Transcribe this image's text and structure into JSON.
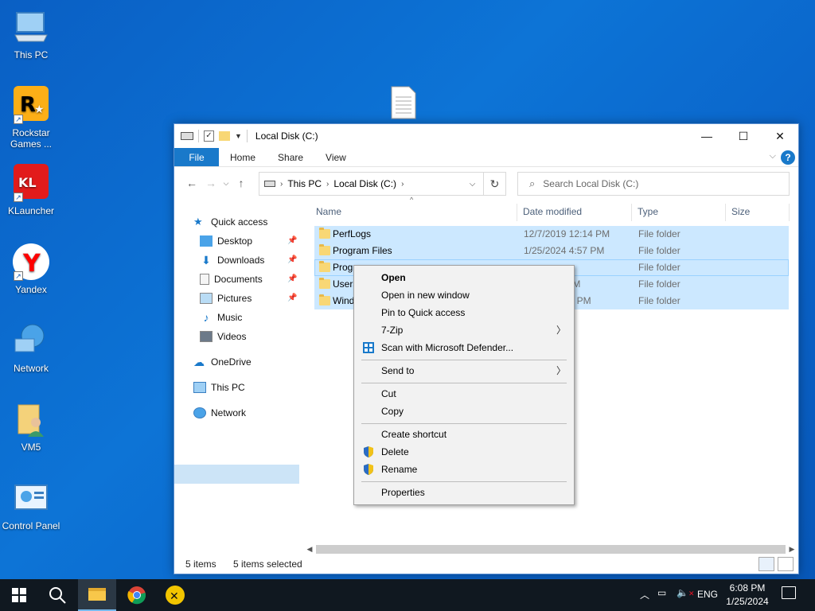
{
  "desktop": {
    "icons": [
      {
        "label": "This PC"
      },
      {
        "label": "Rockstar Games ..."
      },
      {
        "label": "KLauncher"
      },
      {
        "label": "Yandex"
      },
      {
        "label": "Network"
      },
      {
        "label": "VM5"
      },
      {
        "label": "Control Panel"
      }
    ]
  },
  "explorer": {
    "title": "Local Disk (C:)",
    "ribbon_tabs": {
      "file": "File",
      "home": "Home",
      "share": "Share",
      "view": "View"
    },
    "address": {
      "crumb1": "This PC",
      "crumb2": "Local Disk (C:)"
    },
    "search": {
      "placeholder": "Search Local Disk (C:)"
    },
    "nav": {
      "quick_access": "Quick access",
      "desktop": "Desktop",
      "downloads": "Downloads",
      "documents": "Documents",
      "pictures": "Pictures",
      "music": "Music",
      "videos": "Videos",
      "onedrive": "OneDrive",
      "this_pc": "This PC",
      "network": "Network"
    },
    "columns": {
      "name": "Name",
      "date": "Date modified",
      "type": "Type",
      "size": "Size"
    },
    "rows": [
      {
        "name": "PerfLogs",
        "date": "12/7/2019 12:14 PM",
        "type": "File folder"
      },
      {
        "name": "Program Files",
        "date": "1/25/2024 4:57 PM",
        "type": "File folder"
      },
      {
        "name": "Progr",
        "date": "",
        "type": "File folder"
      },
      {
        "name": "Users",
        "date": "1 AM",
        "type": "File folder"
      },
      {
        "name": "Wind",
        "date": "52 PM",
        "type": "File folder"
      }
    ],
    "status": {
      "items": "5 items",
      "selected": "5 items selected"
    }
  },
  "context_menu": {
    "open": "Open",
    "open_new_window": "Open in new window",
    "pin_quick_access": "Pin to Quick access",
    "seven_zip": "7-Zip",
    "scan_defender": "Scan with Microsoft Defender...",
    "send_to": "Send to",
    "cut": "Cut",
    "copy": "Copy",
    "create_shortcut": "Create shortcut",
    "delete": "Delete",
    "rename": "Rename",
    "properties": "Properties"
  },
  "taskbar": {
    "language": "ENG",
    "time": "6:08 PM",
    "date": "1/25/2024"
  },
  "colors": {
    "accent": "#1979ca",
    "selection": "#cce8ff",
    "desktop": "#0a63c9",
    "taskbar": "#101820"
  }
}
